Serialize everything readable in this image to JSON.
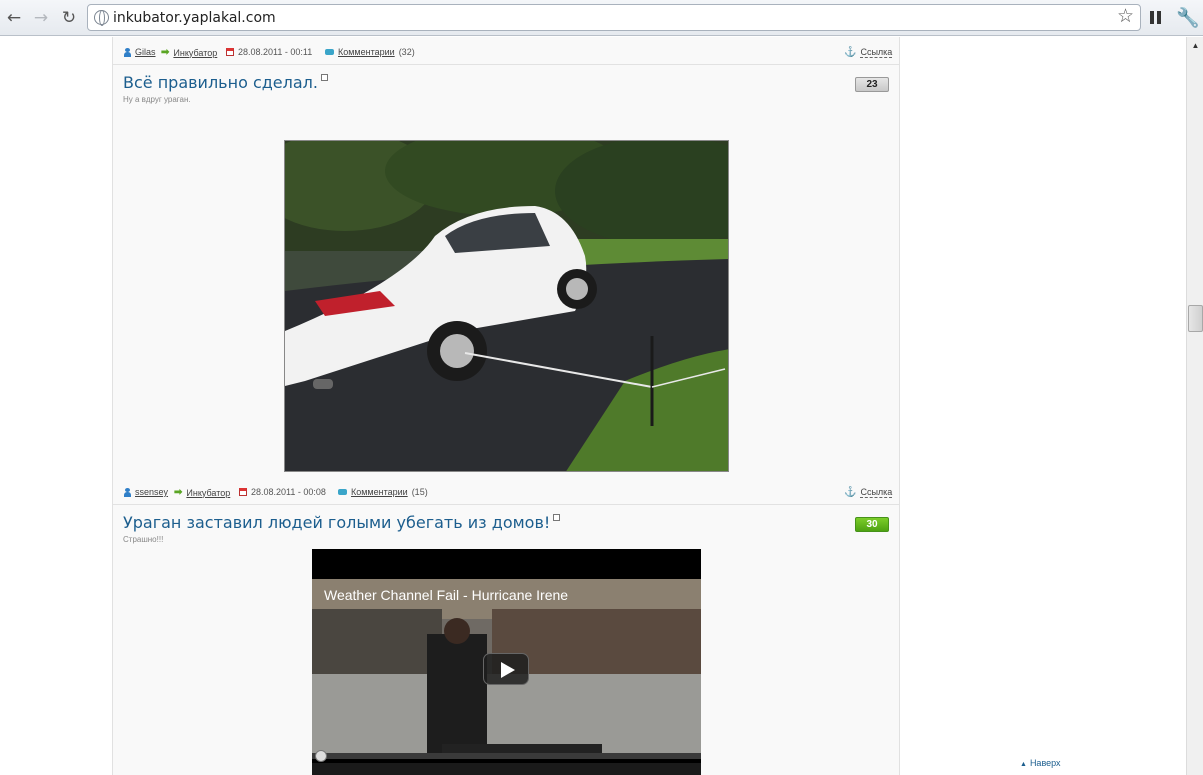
{
  "browser": {
    "url": "inkubator.yaplakal.com",
    "icons": [
      "back-arrow-icon",
      "forward-arrow-icon",
      "reload-icon",
      "globe-icon",
      "star-icon",
      "pause-icon",
      "wrench-icon"
    ]
  },
  "posts": [
    {
      "meta_above": {
        "author": "Gilas",
        "section": "Инкубатор",
        "date": "28.08.2011 - 00:11",
        "comments_label": "Комментарии",
        "comments_count": "(32)",
        "link_label": "Ссылка"
      },
      "title": "Всё правильно сделал.",
      "subtitle": "Ну а вдруг ураган.",
      "rating": "23"
    },
    {
      "meta_above": {
        "author": "ssensey",
        "section": "Инкубатор",
        "date": "28.08.2011 - 00:08",
        "comments_label": "Комментарии",
        "comments_count": "(15)",
        "link_label": "Ссылка"
      },
      "title": "Ураган заставил людей голыми убегать из домов!",
      "subtitle": "Страшно!!!",
      "rating": "30",
      "video_title": "Weather Channel Fail - Hurricane Irene"
    }
  ],
  "footer": {
    "back_to_top": "Наверх"
  },
  "colors": {
    "link_blue": "#1c5e8e",
    "rating_green": "#5cb21a",
    "rating_grey": "#d6d6d6"
  }
}
